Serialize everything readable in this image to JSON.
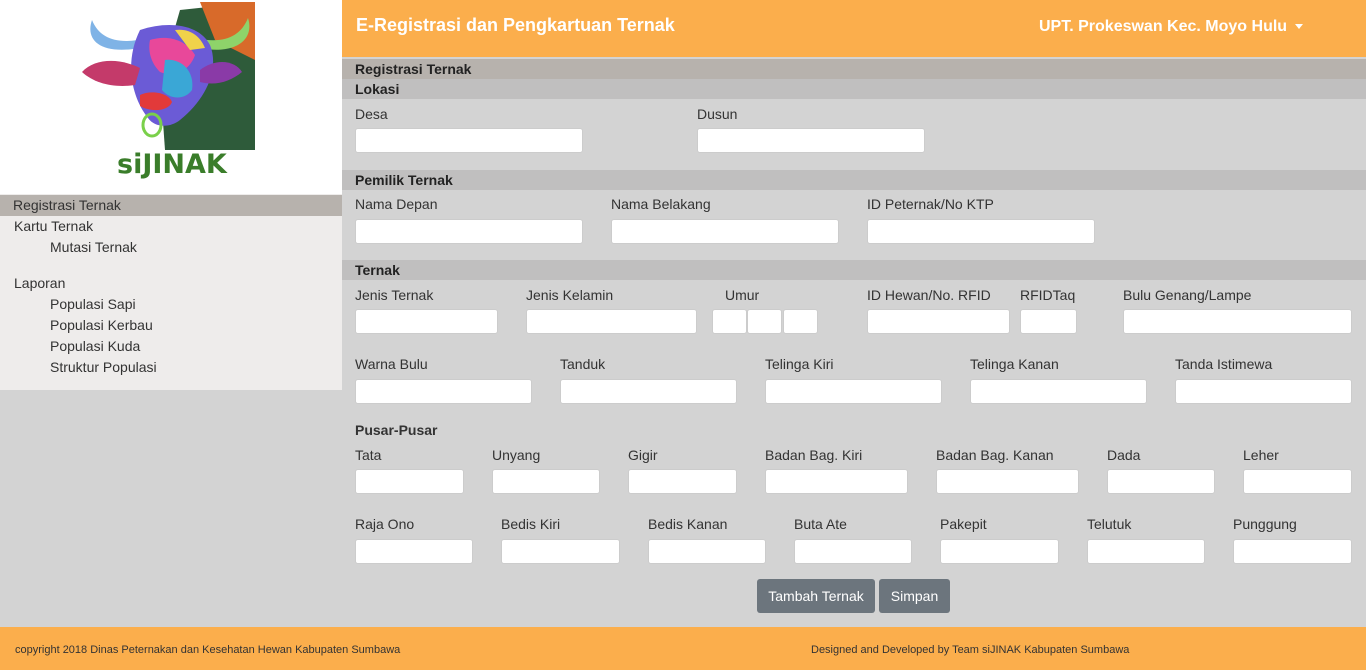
{
  "sidebar": {
    "logo_text": "siJINAK",
    "items": [
      {
        "label": "Registrasi Ternak"
      },
      {
        "label": "Kartu Ternak"
      },
      {
        "label": "Mutasi Ternak"
      },
      {
        "label": "Laporan"
      },
      {
        "label": "Populasi Sapi"
      },
      {
        "label": "Populasi Kerbau"
      },
      {
        "label": "Populasi Kuda"
      },
      {
        "label": "Struktur Populasi"
      }
    ]
  },
  "header": {
    "title": "E-Registrasi dan Pengkartuan Ternak",
    "user": "UPT. Prokeswan Kec. Moyo Hulu"
  },
  "form": {
    "title": "Registrasi Ternak",
    "lokasi": {
      "heading": "Lokasi",
      "desa": "Desa",
      "dusun": "Dusun"
    },
    "pemilik": {
      "heading": "Pemilik Ternak",
      "nama_depan": "Nama Depan",
      "nama_belakang": "Nama Belakang",
      "id_peternak": "ID Peternak/No KTP"
    },
    "ternak": {
      "heading": "Ternak",
      "jenis_ternak": "Jenis Ternak",
      "jenis_kelamin": "Jenis Kelamin",
      "umur": "Umur",
      "id_hewan": "ID Hewan/No. RFID",
      "rfidtaq": "RFIDTaq",
      "bulu_genang": "Bulu Genang/Lampe",
      "warna_bulu": "Warna Bulu",
      "tanduk": "Tanduk",
      "telinga_kiri": "Telinga Kiri",
      "telinga_kanan": "Telinga Kanan",
      "tanda_istimewa": "Tanda Istimewa"
    },
    "pusar": {
      "heading": "Pusar-Pusar",
      "tata": "Tata",
      "unyang": "Unyang",
      "gigir": "Gigir",
      "badan_kiri": "Badan Bag. Kiri",
      "badan_kanan": "Badan Bag. Kanan",
      "dada": "Dada",
      "leher": "Leher",
      "raja_ono": "Raja Ono",
      "bedis_kiri": "Bedis Kiri",
      "bedis_kanan": "Bedis Kanan",
      "buta_ate": "Buta Ate",
      "pakepit": "Pakepit",
      "telutuk": "Telutuk",
      "punggung": "Punggung"
    },
    "buttons": {
      "tambah": "Tambah Ternak",
      "simpan": "Simpan"
    }
  },
  "footer": {
    "copyright": "copyright 2018 Dinas Peternakan dan Kesehatan Hewan Kabupaten Sumbawa",
    "credit": "Designed and Developed by Team siJINAK Kabupaten Sumbawa"
  },
  "colors": {
    "accent": "#fbae4c",
    "button": "#6c757d",
    "band": "#c0bfbf",
    "title_band": "#b7b2ad"
  }
}
